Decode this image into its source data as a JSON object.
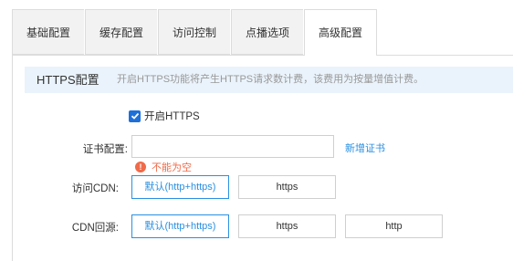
{
  "tabs": [
    {
      "label": "基础配置"
    },
    {
      "label": "缓存配置"
    },
    {
      "label": "访问控制"
    },
    {
      "label": "点播选项"
    },
    {
      "label": "高级配置"
    }
  ],
  "section": {
    "title": "HTTPS配置",
    "description": "开启HTTPS功能将产生HTTPS请求数计费，该费用为按量增值计费。"
  },
  "https_toggle": {
    "label": "开启HTTPS",
    "checked": true
  },
  "certificate": {
    "label": "证书配置:",
    "value": "",
    "add_link": "新增证书",
    "error": "不能为空"
  },
  "access_cdn": {
    "label": "访问CDN:",
    "options": [
      "默认(http+https)",
      "https"
    ],
    "selected": "默认(http+https)"
  },
  "cdn_origin": {
    "label": "CDN回源:",
    "options": [
      "默认(http+https)",
      "https",
      "http"
    ],
    "selected": "默认(http+https)"
  },
  "colors": {
    "accent": "#2a8fe0",
    "error": "#ef6b4a",
    "checkbox": "#1e6fd9",
    "section_bg": "#eaf3fb"
  }
}
